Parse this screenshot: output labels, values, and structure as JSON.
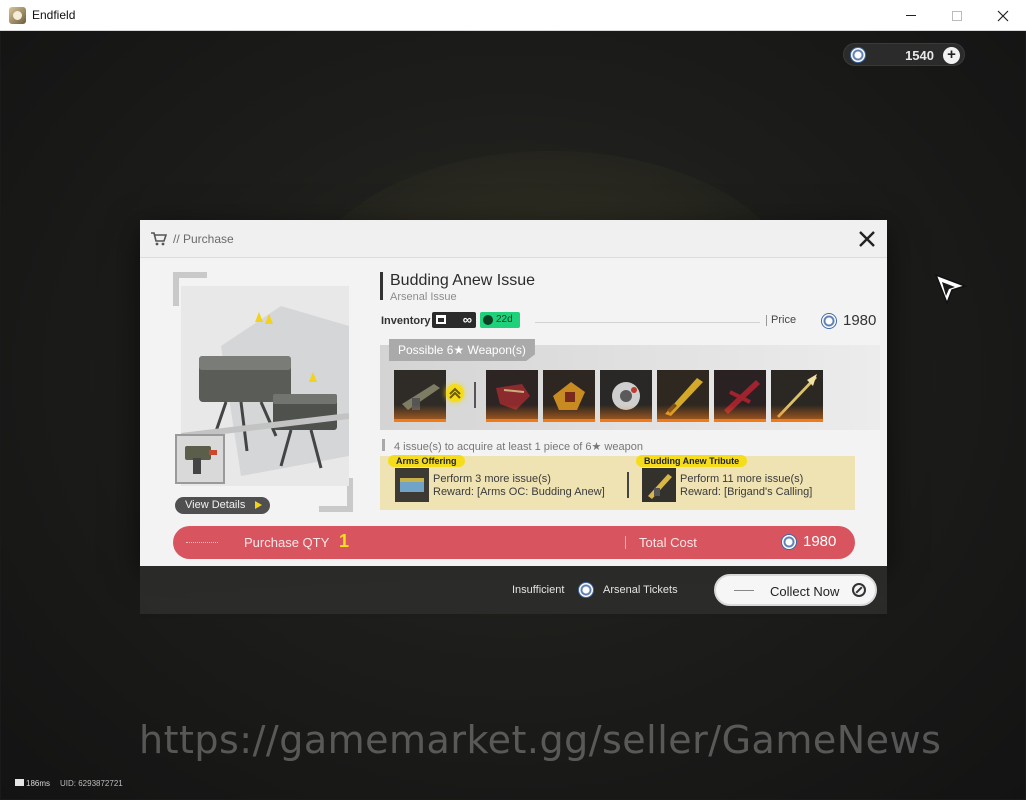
{
  "window": {
    "title": "Endfield"
  },
  "currency": {
    "amount": "1540",
    "add_label": "+"
  },
  "dialog": {
    "header": {
      "title": "// Purchase"
    },
    "preview": {
      "view_details_label": "View Details"
    },
    "item": {
      "title": "Budding Anew Issue",
      "subtitle": "Arsenal Issue",
      "inventory_label": "Inventory",
      "inventory_value": "∞",
      "time_left": "22d",
      "price_label": "Price",
      "price_value": "1980"
    },
    "weapons": {
      "tab_label": "Possible 6★ Weapon(s)",
      "items": [
        {
          "icon": "rifle-weapon-icon"
        },
        {
          "icon": "crimson-arm-weapon-icon"
        },
        {
          "icon": "golden-gauntlet-weapon-icon"
        },
        {
          "icon": "silver-orb-weapon-icon"
        },
        {
          "icon": "golden-sword-weapon-icon"
        },
        {
          "icon": "crimson-sword-weapon-icon"
        },
        {
          "icon": "golden-spear-weapon-icon"
        }
      ]
    },
    "hint": "4 issue(s) to acquire at least 1 piece of 6★ weapon",
    "rewards": [
      {
        "tag": "Arms Offering",
        "line1": "Perform 3 more issue(s)",
        "line2": "Reward: [Arms OC: Budding Anew]"
      },
      {
        "tag": "Budding Anew Tribute",
        "line1": "Perform 11 more issue(s)",
        "line2": "Reward: [Brigand's Calling]"
      }
    ],
    "purchase": {
      "qty_label": "Purchase QTY",
      "qty_value": "1",
      "total_label": "Total Cost",
      "total_value": "1980"
    }
  },
  "footer": {
    "insufficient_label": "Insufficient",
    "ticket_label": "Arsenal Tickets",
    "collect_label": "Collect Now"
  },
  "watermark": "https://gamemarket.gg/seller/GameNews",
  "status": {
    "ping": "186ms",
    "uid": "UID: 6293872721"
  },
  "colors": {
    "accent_red": "#d8555f",
    "highlight_yellow": "#f5dd1c",
    "timer_green": "#1fd17a",
    "weapon_orange": "#f07a1a"
  }
}
